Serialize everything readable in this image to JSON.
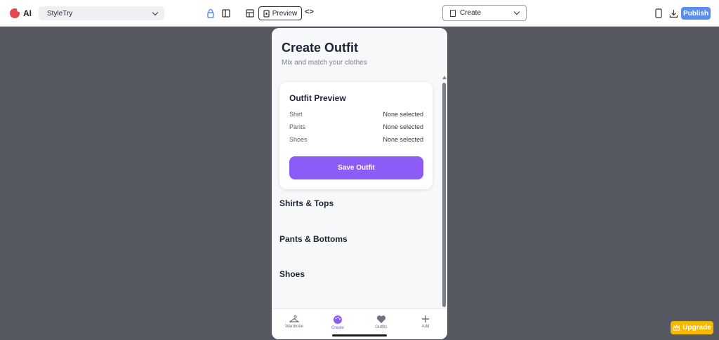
{
  "toolbar": {
    "ai_label": "AI",
    "project_name": "StyleTry",
    "preview_label": "Preview",
    "code_label": "<>",
    "page_select": "Create",
    "publish_label": "Publish"
  },
  "screen": {
    "title": "Create Outfit",
    "subtitle": "Mix and match your clothes",
    "preview_card": {
      "title": "Outfit Preview",
      "rows": [
        {
          "label": "Shirt",
          "value": "None selected"
        },
        {
          "label": "Pants",
          "value": "None selected"
        },
        {
          "label": "Shoes",
          "value": "None selected"
        }
      ],
      "save_label": "Save Outfit"
    },
    "sections": [
      "Shirts & Tops",
      "Pants & Bottoms",
      "Shoes"
    ],
    "nav": [
      {
        "label": "Wardrobe",
        "icon": "hanger-icon"
      },
      {
        "label": "Create",
        "icon": "palette-icon"
      },
      {
        "label": "Outfits",
        "icon": "heart-icon"
      },
      {
        "label": "Add",
        "icon": "plus-icon"
      }
    ]
  },
  "upgrade_label": "Upgrade",
  "colors": {
    "accent": "#8b5cf6",
    "publish": "#5b8def",
    "upgrade": "#f5b800"
  }
}
